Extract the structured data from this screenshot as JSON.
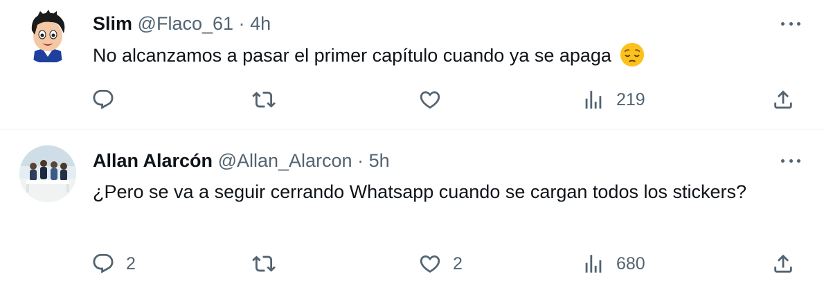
{
  "tweets": [
    {
      "name": "Slim",
      "handle": "@Flaco_61",
      "separator": "·",
      "time": "4h",
      "text": "No alcanzamos a pasar el primer capítulo cuando ya se apaga",
      "emoji": "pensive-face-emoji",
      "replies": "",
      "retweets": "",
      "likes": "",
      "views": "219"
    },
    {
      "name": "Allan Alarcón",
      "handle": "@Allan_Alarcon",
      "separator": "·",
      "time": "5h",
      "text": "¿Pero se va a seguir cerrando Whatsapp cuando se cargan todos los stickers?",
      "replies": "2",
      "retweets": "",
      "likes": "2",
      "views": "680"
    }
  ],
  "icons": {
    "reply": "reply-icon",
    "retweet": "retweet-icon",
    "like": "heart-icon",
    "views": "views-icon",
    "share": "share-icon",
    "more": "more-icon"
  },
  "colors": {
    "text": "#0f1419",
    "secondary": "#536471",
    "divider": "#eff3f4"
  }
}
